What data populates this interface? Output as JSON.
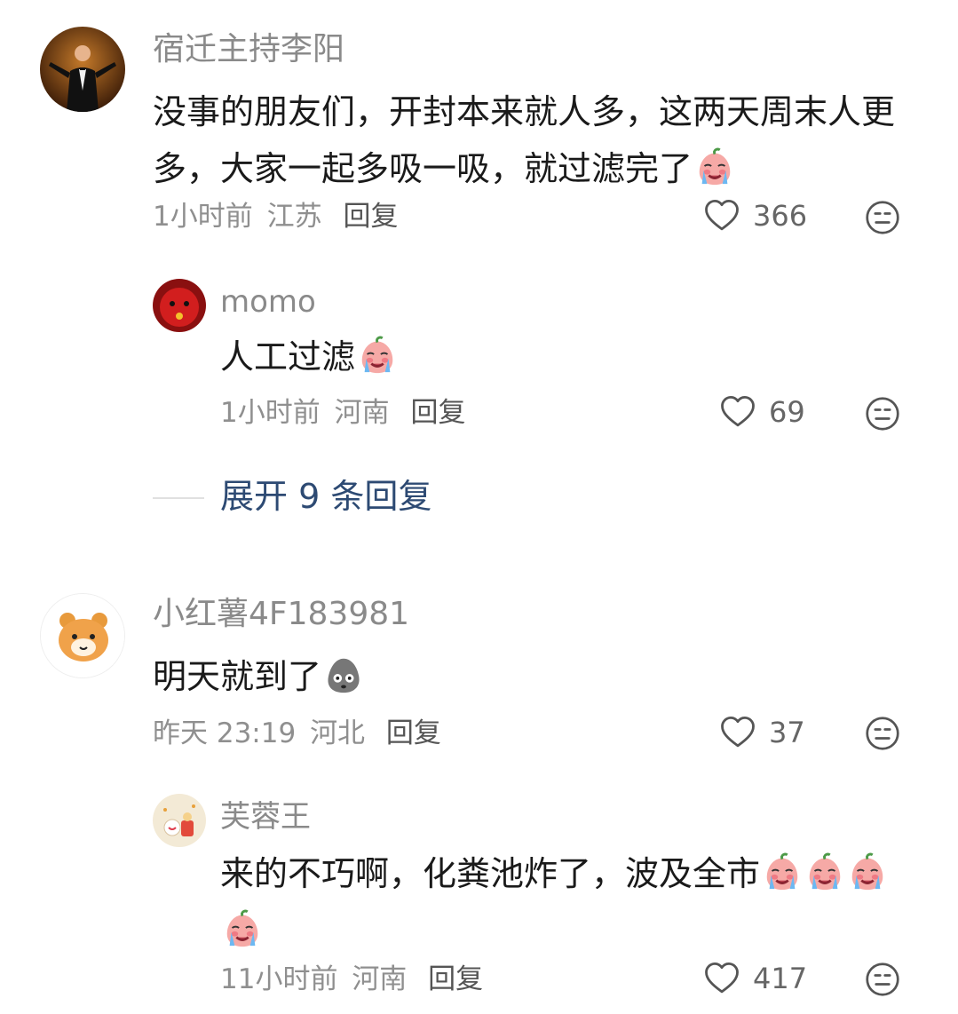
{
  "comments": [
    {
      "user": "宿迁主持李阳",
      "text": "没事的朋友们，开封本来就人多，这两天周末人更多，大家一起多吸一吸，就过滤完了",
      "time": "1小时前",
      "location": "江苏",
      "reply_label": "回复",
      "likes": "366",
      "emoji": "crying-peach-emoji",
      "replies": [
        {
          "user": "momo",
          "text": "人工过滤",
          "time": "1小时前",
          "location": "河南",
          "reply_label": "回复",
          "likes": "69",
          "emoji": "crying-peach-emoji"
        }
      ],
      "expand_label": "展开 9 条回复"
    },
    {
      "user": "小红薯4F183981",
      "text": "明天就到了",
      "time": "昨天 23:19",
      "location": "河北",
      "reply_label": "回复",
      "likes": "37",
      "emoji": "shocked-stone-emoji",
      "replies": [
        {
          "user": "芙蓉王",
          "text": "来的不巧啊，化粪池炸了，波及全市",
          "time": "11小时前",
          "location": "河南",
          "reply_label": "回复",
          "likes": "417",
          "emoji": "crying-peach-emoji"
        }
      ]
    }
  ],
  "colors": {
    "username": "#8a8a8a",
    "meta": "#8f8f8f",
    "expand_link": "#2d4a73"
  },
  "icons": [
    "heart-outline-icon",
    "dislike-face-icon"
  ]
}
